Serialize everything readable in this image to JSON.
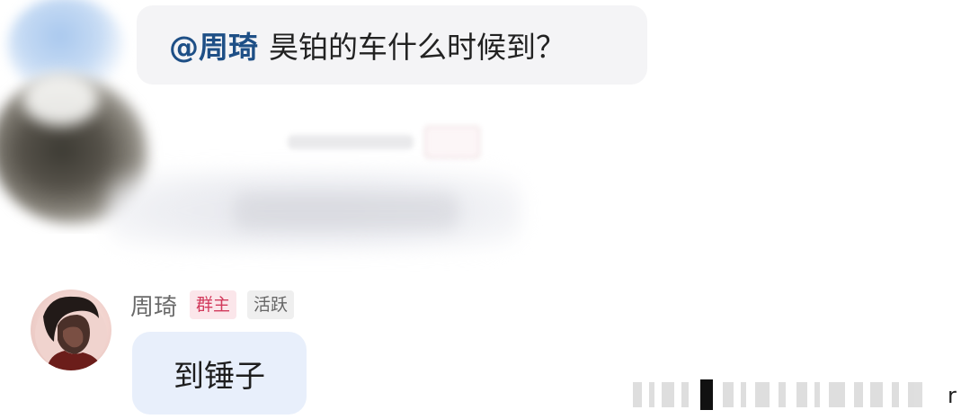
{
  "top_message": {
    "mention": "@周琦",
    "text": "昊铂的车什么时候到？"
  },
  "bottom_message": {
    "sender_name": "周琦",
    "badges": {
      "owner": "群主",
      "active": "活跃"
    },
    "text": "到锤子"
  },
  "colors": {
    "mention": "#1e4f86",
    "owner_badge_text": "#d23a5c",
    "owner_badge_bg": "#fbe6ea",
    "active_badge_bg": "#efefef",
    "top_bubble_bg": "#f4f4f6",
    "bottom_bubble_bg": "#e8effb"
  },
  "icons": {
    "blurred_avatar": "blurred-avatar-photo",
    "avatar": "user-avatar-photo"
  },
  "corner_glyph": "r"
}
